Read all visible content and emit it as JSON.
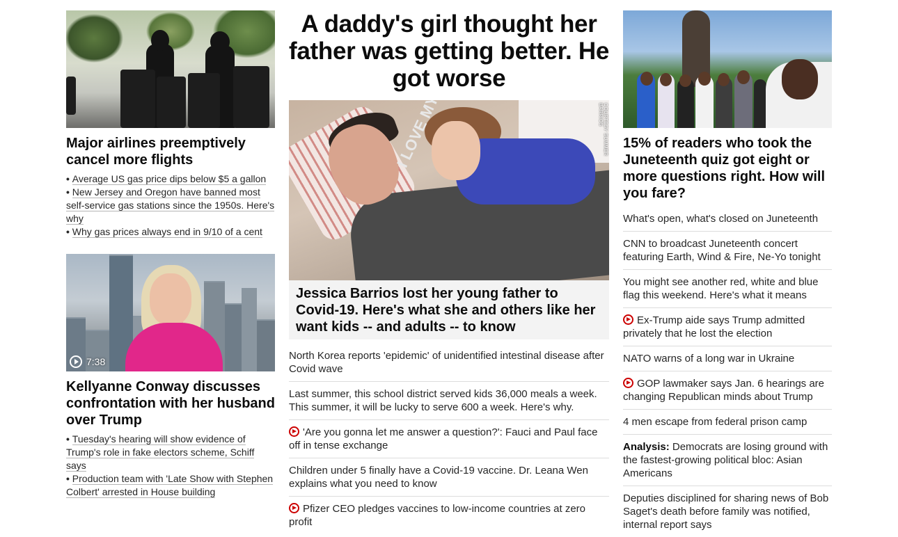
{
  "left": {
    "story1": {
      "headline": "Major airlines preemptively cancel more flights",
      "bullets": [
        "Average US gas price dips below $5 a gallon",
        "New Jersey and Oregon have banned most self-service gas stations since the 1950s. Here's why",
        "Why gas prices always end in 9/10 of a cent"
      ]
    },
    "story2": {
      "video_duration": "7:38",
      "headline": "Kellyanne Conway discusses confrontation with her husband over Trump",
      "bullets": [
        "Tuesday's hearing will show evidence of Trump's role in fake electors scheme, Schiff says",
        "Production team with 'Late Show with Stephen Colbert' arrested in House building"
      ]
    }
  },
  "middle": {
    "banner": "A daddy's girl thought her father was getting better. He got worse",
    "photo_credit": "COURTESY SUMMER BARRIOS",
    "shirt_text": "I LOVE MY WIFE",
    "lead_caption": "Jessica Barrios lost her young father to Covid-19. Here's what she and others like her want kids -- and adults -- to know",
    "links": [
      {
        "text": "North Korea reports 'epidemic' of unidentified intestinal disease after Covid wave",
        "video": false
      },
      {
        "text": "Last summer, this school district served kids 36,000 meals a week. This summer, it will be lucky to serve 600 a week. Here's why.",
        "video": false
      },
      {
        "text": "'Are you gonna let me answer a question?': Fauci and Paul face off in tense exchange",
        "video": true
      },
      {
        "text": "Children under 5 finally have a Covid-19 vaccine. Dr. Leana Wen explains what you need to know",
        "video": false
      },
      {
        "text": "Pfizer CEO pledges vaccines to low-income countries at zero profit",
        "video": true
      }
    ]
  },
  "right": {
    "headline": "15% of readers who took the Juneteenth quiz got eight or more questions right. How will you fare?",
    "links": [
      {
        "text": "What's open, what's closed on Juneteenth",
        "video": false,
        "label": ""
      },
      {
        "text": "CNN to broadcast Juneteenth concert featuring Earth, Wind & Fire, Ne-Yo tonight",
        "video": false,
        "label": ""
      },
      {
        "text": "You might see another red, white and blue flag this weekend. Here's what it means",
        "video": false,
        "label": ""
      },
      {
        "text": "Ex-Trump aide says Trump admitted privately that he lost the election",
        "video": true,
        "label": ""
      },
      {
        "text": "NATO warns of a long war in Ukraine",
        "video": false,
        "label": ""
      },
      {
        "text": "GOP lawmaker says Jan. 6 hearings are changing Republican minds about Trump",
        "video": true,
        "label": ""
      },
      {
        "text": "4 men escape from federal prison camp",
        "video": false,
        "label": ""
      },
      {
        "text": "Democrats are losing ground with the fastest-growing political bloc: Asian Americans",
        "video": false,
        "label": "Analysis:"
      },
      {
        "text": "Deputies disciplined for sharing news of Bob Saget's death before family was notified, internal report says",
        "video": false,
        "label": ""
      }
    ]
  },
  "colors": {
    "video_icon": "#cc0000",
    "caption_bg": "#f3f3f3",
    "divider": "#dcdcdc"
  }
}
